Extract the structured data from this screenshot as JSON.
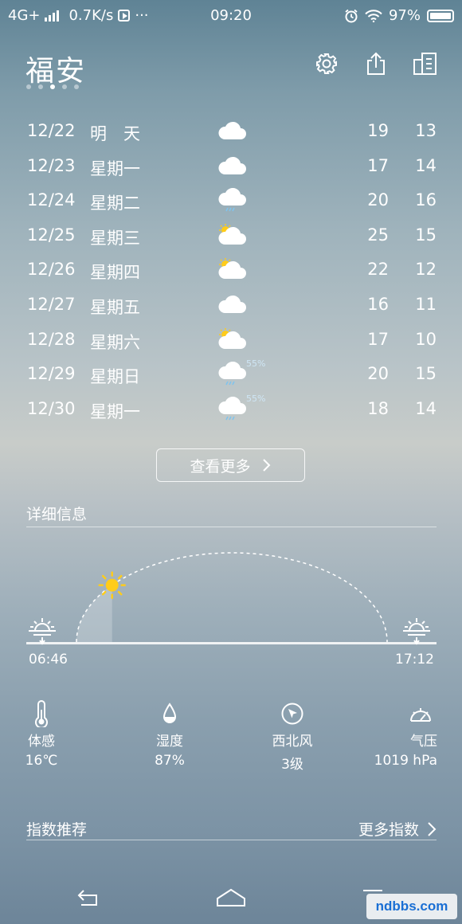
{
  "status_bar": {
    "network": "4G+",
    "speed": "0.7K/s",
    "more": "···",
    "time": "09:20",
    "battery": "97%"
  },
  "header": {
    "city": "福安",
    "page_count": 5,
    "active_page": 3
  },
  "forecast": [
    {
      "date": "12/22",
      "day": "明　天",
      "icon": "cloudy",
      "pop": "",
      "hi": "19",
      "lo": "13"
    },
    {
      "date": "12/23",
      "day": "星期一",
      "icon": "cloudy",
      "pop": "",
      "hi": "17",
      "lo": "14"
    },
    {
      "date": "12/24",
      "day": "星期二",
      "icon": "light-rain",
      "pop": "",
      "hi": "20",
      "lo": "16"
    },
    {
      "date": "12/25",
      "day": "星期三",
      "icon": "partly-cloudy",
      "pop": "",
      "hi": "25",
      "lo": "15"
    },
    {
      "date": "12/26",
      "day": "星期四",
      "icon": "partly-cloudy",
      "pop": "",
      "hi": "22",
      "lo": "12"
    },
    {
      "date": "12/27",
      "day": "星期五",
      "icon": "cloudy",
      "pop": "",
      "hi": "16",
      "lo": "11"
    },
    {
      "date": "12/28",
      "day": "星期六",
      "icon": "partly-cloudy",
      "pop": "",
      "hi": "17",
      "lo": "10"
    },
    {
      "date": "12/29",
      "day": "星期日",
      "icon": "light-rain",
      "pop": "55%",
      "hi": "20",
      "lo": "15"
    },
    {
      "date": "12/30",
      "day": "星期一",
      "icon": "light-rain",
      "pop": "55%",
      "hi": "18",
      "lo": "14"
    }
  ],
  "more_button": {
    "label": "查看更多",
    "icon": "chevron-right-icon"
  },
  "details_section": {
    "title": "详细信息",
    "sunrise": "06:46",
    "sunset": "17:12",
    "sun_progress": 0.22
  },
  "details": [
    {
      "icon": "thermometer-icon",
      "label": "体感",
      "value": "16℃"
    },
    {
      "icon": "droplet-icon",
      "label": "湿度",
      "value": "87%"
    },
    {
      "icon": "wind-direction-icon",
      "label": "西北风",
      "value": "3级"
    },
    {
      "icon": "barometer-icon",
      "label": "气压",
      "value": "1019 hPa"
    }
  ],
  "index_section": {
    "title": "指数推荐",
    "more_label": "更多指数"
  },
  "watermark": {
    "text": "ndbbs.com"
  },
  "colors": {
    "sun": "#ffcc1a",
    "text": "#ffffff"
  }
}
